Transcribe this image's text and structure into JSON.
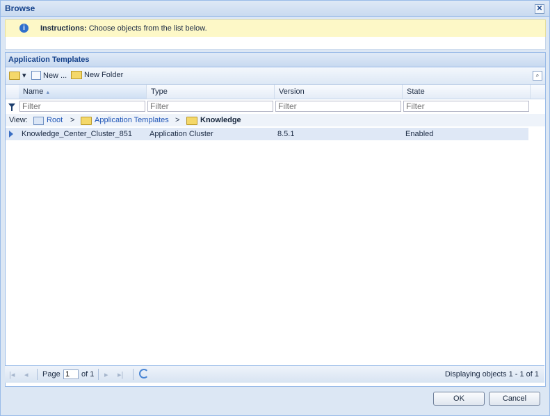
{
  "window": {
    "title": "Browse",
    "close_symbol": "✕"
  },
  "instructions": {
    "label": "Instructions:",
    "text": "Choose objects from the list below.",
    "icon": "info-icon"
  },
  "panel": {
    "title": "Application Templates"
  },
  "toolbar": {
    "new_label": "New ...",
    "new_folder_label": "New Folder",
    "dropdown_arrow": "▾"
  },
  "grid": {
    "columns": [
      "Name",
      "Type",
      "Version",
      "State"
    ],
    "sort_indicator": "▲",
    "filter_placeholder": "Filter",
    "view": {
      "label": "View:",
      "crumbs": [
        "Root",
        "Application Templates",
        "Knowledge"
      ],
      "separator": ">"
    },
    "rows": [
      {
        "name": "Knowledge_Center_Cluster_851",
        "type": "Application Cluster",
        "version": "8.5.1",
        "state": "Enabled"
      }
    ]
  },
  "pager": {
    "page_label": "Page",
    "page_value": "1",
    "of_label": "of 1",
    "status": "Displaying objects 1 - 1 of 1"
  },
  "buttons": {
    "ok": "OK",
    "cancel": "Cancel"
  },
  "colors": {
    "accent": "#15428b",
    "border": "#99bbe8",
    "instructions_bg": "#fdf8c7",
    "selected_row": "#dfe8f6"
  }
}
